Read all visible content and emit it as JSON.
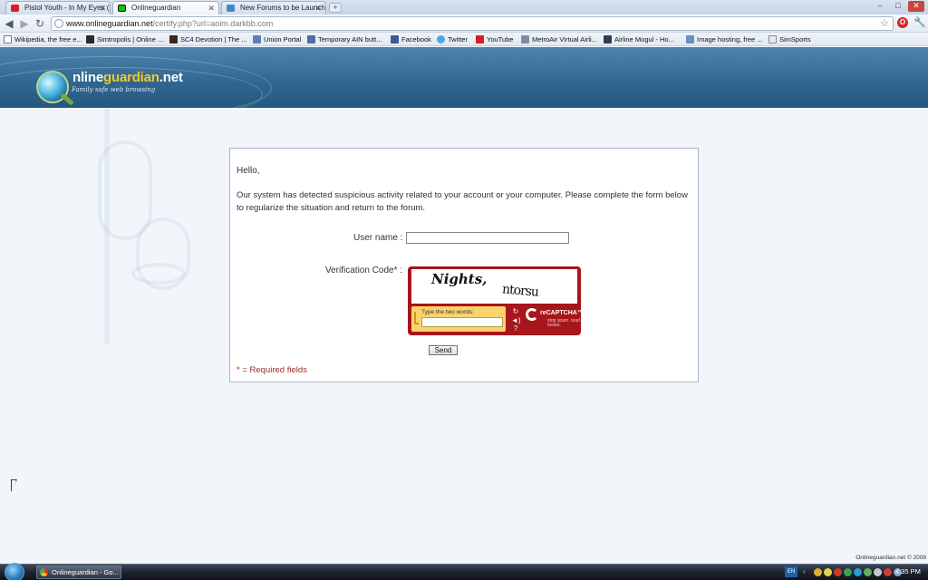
{
  "browser": {
    "tabs": [
      {
        "label": "Pistol Youth - In My Eyes (n",
        "icon": "youtube-icon",
        "color": "#d51f26"
      },
      {
        "label": "Onlineguardian",
        "icon": "onlineguardian-icon",
        "color": "#12c40f"
      },
      {
        "label": "New Forums to be Launche",
        "icon": "forum-icon",
        "color": "#3a8ac8"
      }
    ],
    "new_tab": "+",
    "window_buttons": [
      "–",
      "□",
      "✕"
    ],
    "url_host": "www.onlineguardian.net",
    "url_path": "/certify.php?url=aoim.darkbb.com",
    "bookmarks": [
      {
        "label": "Wikipedia, the free e...",
        "icon": "wikipedia-icon"
      },
      {
        "label": "Simtropolis | Online ...",
        "icon": "simtropolis-icon"
      },
      {
        "label": "SC4 Devotion | The ...",
        "icon": "sc4devotion-icon"
      },
      {
        "label": "Union Portal",
        "icon": "union-portal-icon"
      },
      {
        "label": "Temporary AIN butt...",
        "icon": "ain-icon"
      },
      {
        "label": "Facebook",
        "icon": "facebook-icon"
      },
      {
        "label": "Twitter",
        "icon": "twitter-icon"
      },
      {
        "label": "YouTube",
        "icon": "youtube-icon"
      },
      {
        "label": "MetroAir Virtual Airli...",
        "icon": "metroair-icon"
      },
      {
        "label": "Airline Mogul - Ho...",
        "icon": "airline-mogul-icon"
      },
      {
        "label": "Image hosting, free ...",
        "icon": "image-hosting-icon"
      },
      {
        "label": "SimSports",
        "icon": "simsports-icon"
      }
    ]
  },
  "site": {
    "logo_prefix": "nline",
    "logo_accent": "guardian",
    "logo_suffix": ".net",
    "tagline": "Family safe web browsing",
    "footer": "Onlineguardian.net © 2008"
  },
  "form": {
    "greeting": "Hello,",
    "message": "Our system has detected suspicious activity related to your account or your computer. Please complete the form below to regularize the situation and return to the forum.",
    "username_label": "User name :",
    "username_value": "",
    "verification_label": "Verification Code* :",
    "captcha": {
      "word1": "Nights,",
      "word2": "ntorsu",
      "prompt": "Type the two words:",
      "brand": "reCAPTCHA™",
      "tagline": "stop spam. read books."
    },
    "send_label": "Send",
    "required_note": "* = Required fields"
  },
  "taskbar": {
    "task_label": "Onlineguardian - Go...",
    "language": "EN",
    "clock": "4:35 PM"
  }
}
